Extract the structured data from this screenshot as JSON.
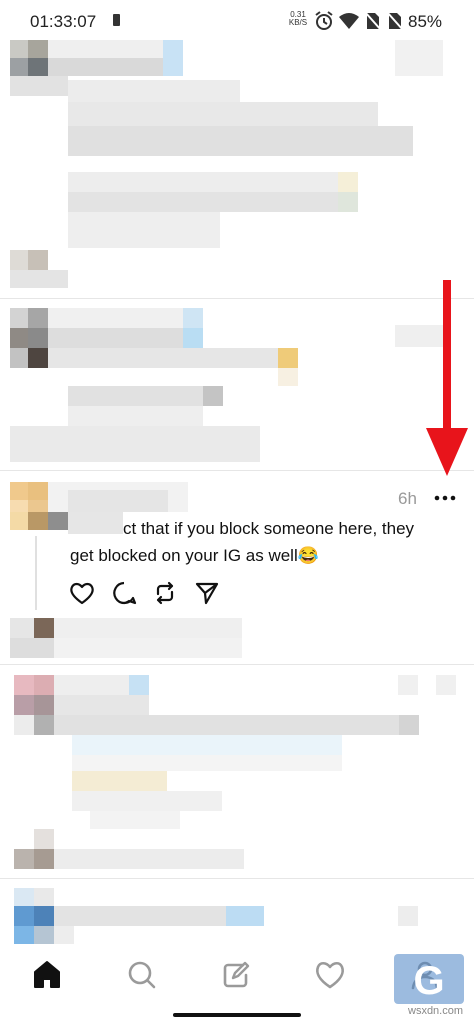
{
  "status_bar": {
    "time": "01:33:07",
    "net_speed_value": "0.31",
    "net_speed_unit": "KB/S",
    "battery_percent": "85%"
  },
  "post": {
    "time_ago": "6h",
    "text_line_1": "ct that if you block someone here, they",
    "text_line_2": "get blocked on your IG as well😂"
  },
  "watermark": {
    "logo": "G",
    "text": "wsxdn.com"
  },
  "colors": {
    "annotation_arrow": "#e8141b",
    "icon": "#111111",
    "muted_text": "#999999"
  }
}
